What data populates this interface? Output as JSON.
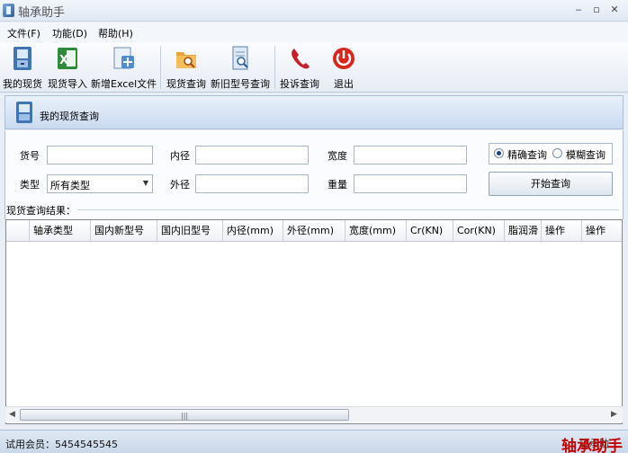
{
  "window": {
    "title": "轴承助手",
    "minimize": "‒",
    "maximize": "▫",
    "close": "✕"
  },
  "menu": [
    "文件(F)",
    "功能(D)",
    "帮助(H)"
  ],
  "toolbar": {
    "my_stock": "我的现货",
    "stock_import": "现货导入",
    "new_excel": "新增Excel文件",
    "stock_query": "现货查询",
    "model_query": "新旧型号查询",
    "complaint": "投诉查询",
    "exit": "退出"
  },
  "panel": {
    "title": "我的现货查询"
  },
  "form": {
    "part_no_label": "货号",
    "inner_label": "内径",
    "width_label": "宽度",
    "type_label": "类型",
    "type_value": "所有类型",
    "outer_label": "外径",
    "weight_label": "重量",
    "exact_label": "精确查询",
    "fuzzy_label": "模糊查询",
    "search_button": "开始查询"
  },
  "results": {
    "label": "现货查询结果：",
    "columns": [
      "轴承类型",
      "国内新型号",
      "国内旧型号",
      "内径(mm)",
      "外径(mm)",
      "宽度(mm)",
      "Cr(KN)",
      "Cor(KN)",
      "脂润滑",
      "操作",
      "操作"
    ]
  },
  "status": {
    "user": "试用会员：5454545545",
    "right": "轴承助"
  },
  "watermark": "轴承助手",
  "colors": {
    "accent": "#2b5f9b",
    "watermark": "#c20000"
  }
}
